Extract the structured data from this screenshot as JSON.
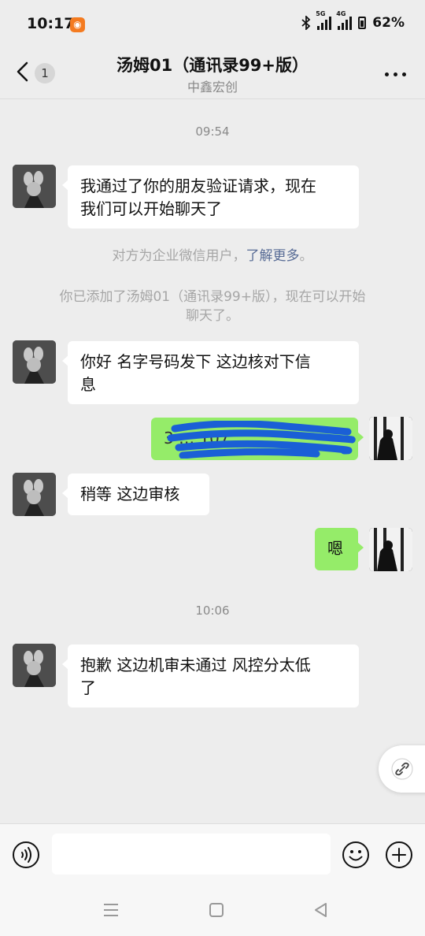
{
  "status_bar": {
    "time": "10:17",
    "battery": "62%",
    "net1": "5G",
    "net2": "4G"
  },
  "header": {
    "back_count": "1",
    "title": "汤姆01（通讯录99+版）",
    "subtitle": "中鑫宏创"
  },
  "messages": {
    "ts1": "09:54",
    "m1": [
      "我通过了你的朋友验证请求，现在",
      "我们可以开始聊天了"
    ],
    "sys1_text": "对方为企业微信用户，",
    "sys1_link": "了解更多",
    "sys1_end": "。",
    "sys2": [
      "你已添加了汤姆01（通讯录99+版），现在可以开始",
      "聊天了。"
    ],
    "m2": [
      "你好  名字号码发下  这边核对下信",
      "息"
    ],
    "m3": "3 … 107",
    "m4": "稍等  这边审核",
    "m5": "嗯",
    "ts2": "10:06",
    "m6": [
      "抱歉  这边机审未通过  风控分太低",
      "了"
    ]
  },
  "colors": {
    "my_bubble": "#95ec69",
    "link": "#576b95",
    "background": "#ededed"
  }
}
